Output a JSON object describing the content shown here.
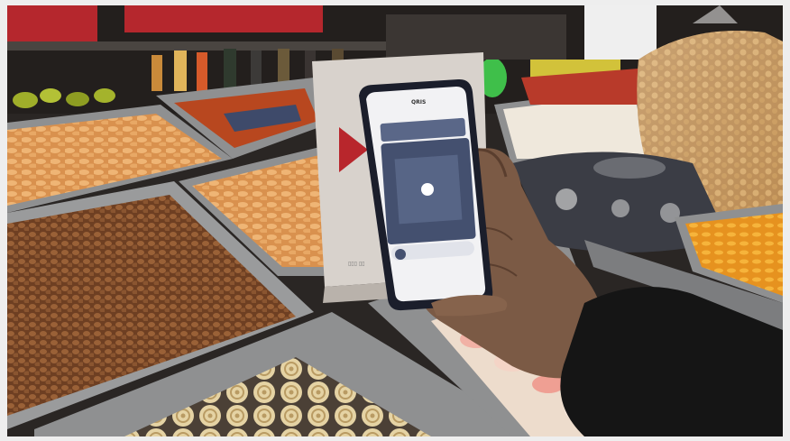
{
  "photo": {
    "phone_screen_header": "QRIS",
    "colors": {
      "page_bg": "#eeeeee",
      "shelf_dark": "#231f1d",
      "red_banner": "#b5272d",
      "tray_metal": "#8f9091",
      "chips_orange": "#e3a25f",
      "peanuts_brown": "#7a4a28",
      "crackers_beige": "#e7d8ae",
      "phone_body": "#1b1e2b",
      "qr_screen": "#44506f",
      "sign_red": "#b8262c",
      "sleeve_black": "#151515",
      "skin": "#7b5a45"
    }
  }
}
